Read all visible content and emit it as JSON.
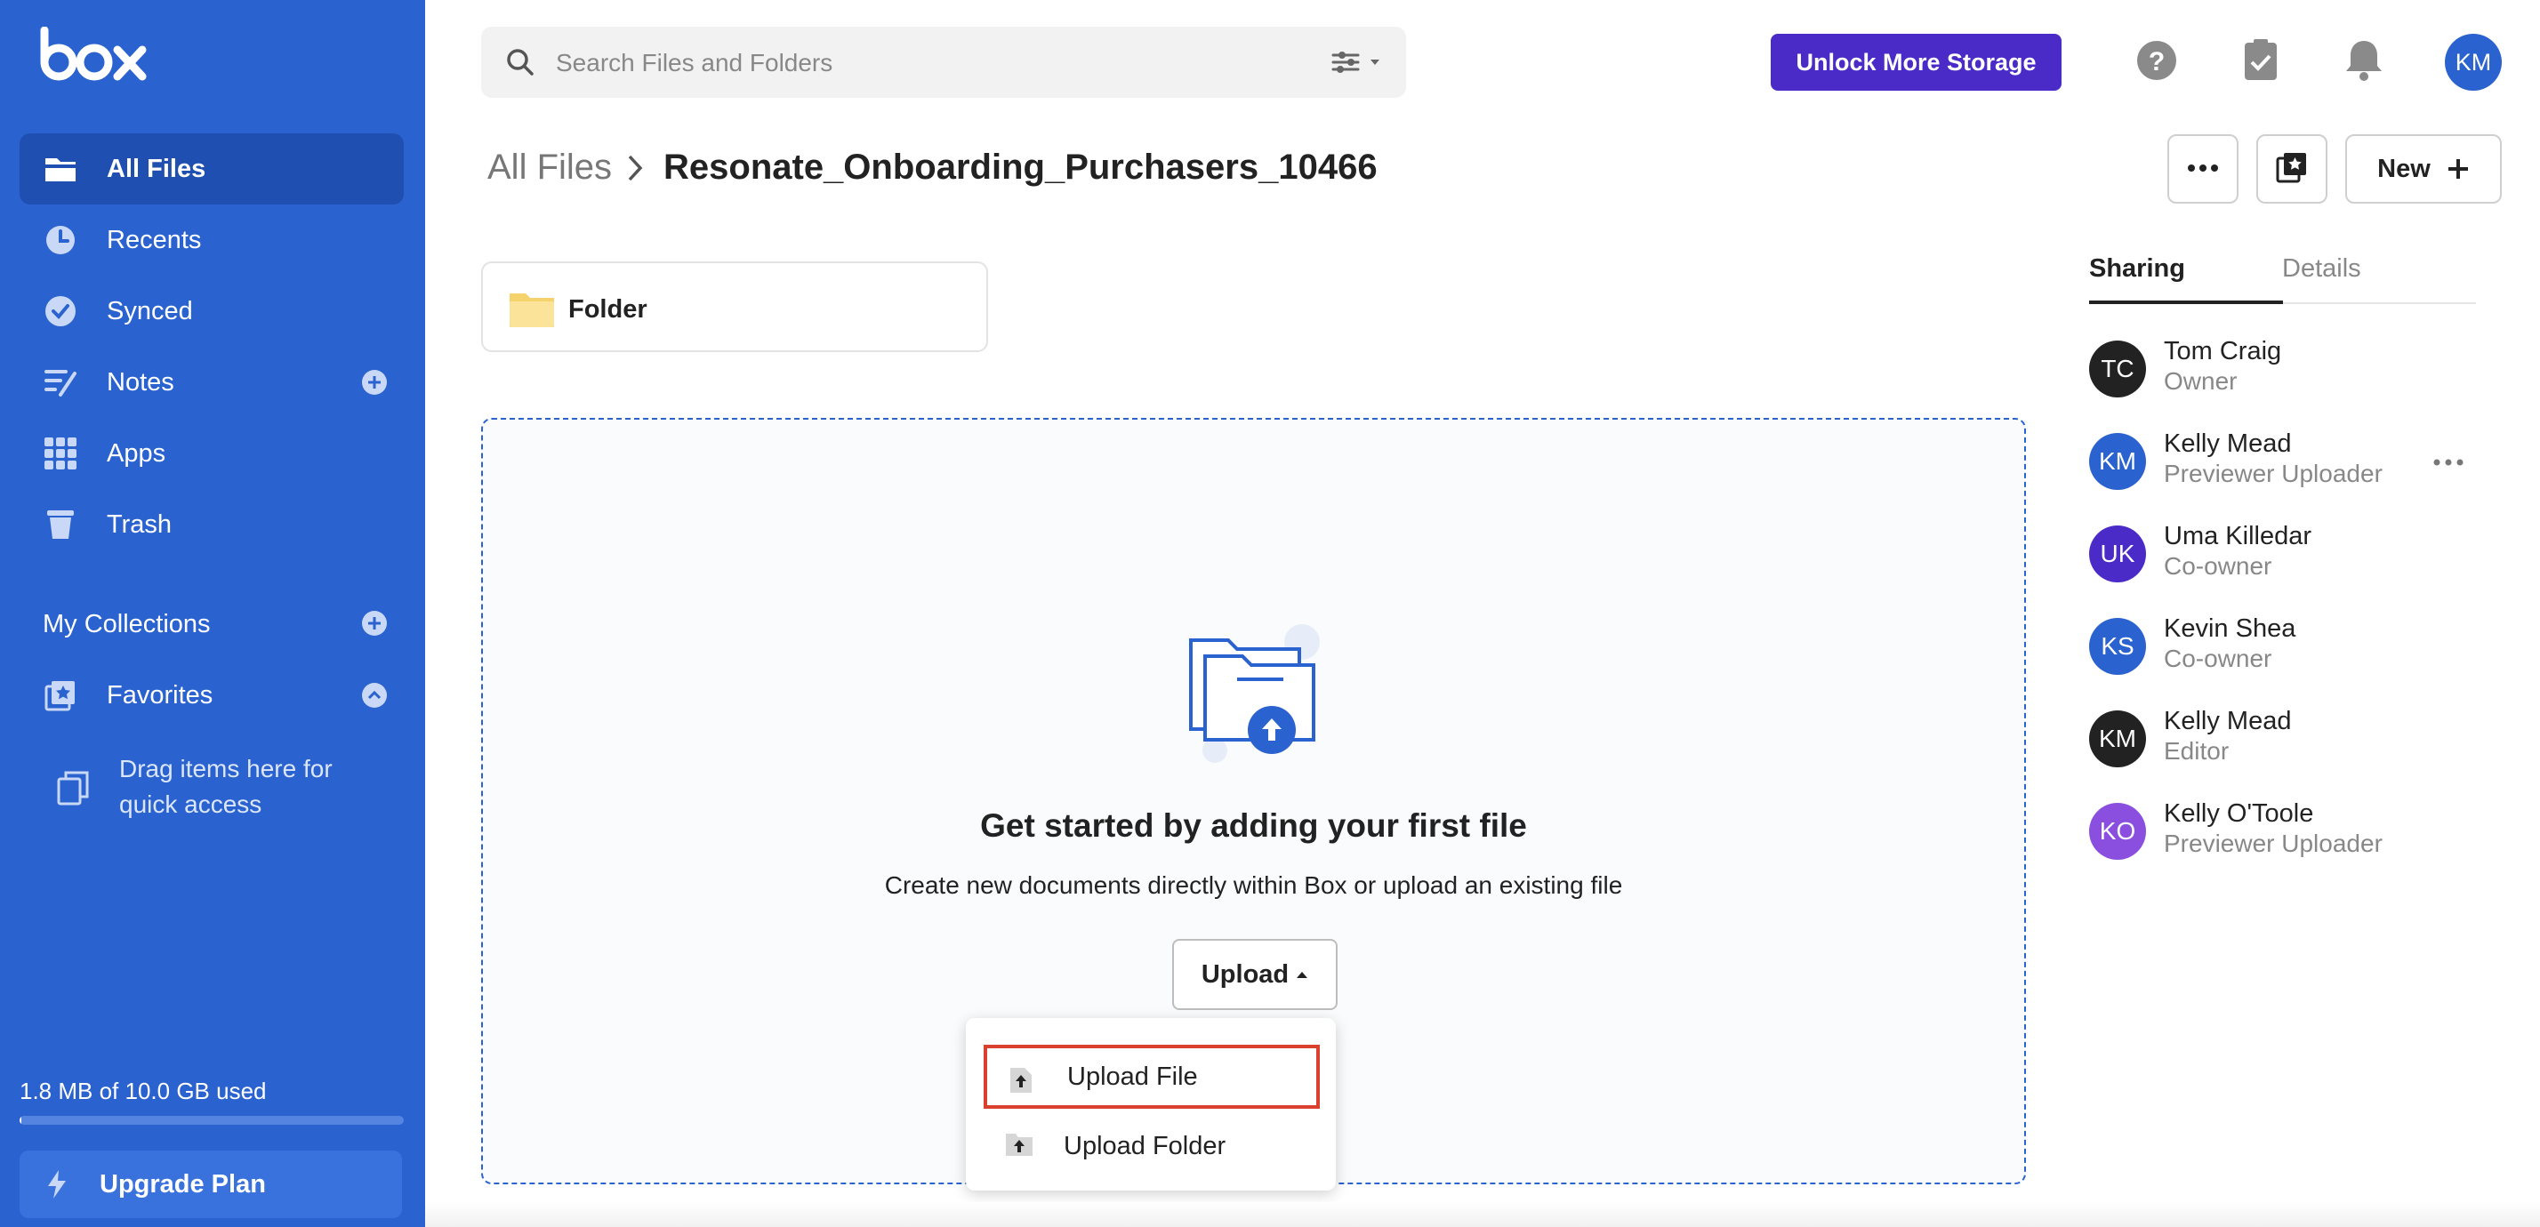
{
  "brand": {
    "logo_text": "box",
    "accent": "#2a62cf",
    "sidebar_active": "#1f4fb0"
  },
  "sidebar": {
    "items": [
      {
        "label": "All Files",
        "icon": "folder-icon",
        "active": true
      },
      {
        "label": "Recents",
        "icon": "clock-icon"
      },
      {
        "label": "Synced",
        "icon": "check-circle-icon"
      },
      {
        "label": "Notes",
        "icon": "notes-icon",
        "has_add": true
      },
      {
        "label": "Apps",
        "icon": "apps-grid-icon"
      },
      {
        "label": "Trash",
        "icon": "trash-icon"
      }
    ],
    "collections_label": "My Collections",
    "favorites_label": "Favorites",
    "drag_hint": "Drag items here for quick access",
    "storage_text": "1.8 MB of 10.0 GB used",
    "storage_fraction": 0.0002,
    "upgrade_label": "Upgrade Plan"
  },
  "search": {
    "placeholder": "Search Files and Folders",
    "value": ""
  },
  "header": {
    "unlock_label": "Unlock More Storage",
    "unlock_color": "#4b2bc7",
    "user_initials": "KM",
    "icons": [
      "help-icon",
      "tasks-clipboard-icon",
      "notifications-bell-icon"
    ]
  },
  "breadcrumb": {
    "root": "All Files",
    "current": "Resonate_Onboarding_Purchasers_10466"
  },
  "actions": {
    "new_label": "New"
  },
  "folder": {
    "label": "Folder"
  },
  "empty_state": {
    "title": "Get started by adding your first file",
    "subtitle": "Create new documents directly within Box or upload an existing file",
    "upload_label": "Upload"
  },
  "upload_menu": {
    "items": [
      {
        "label": "Upload File",
        "highlighted": true
      },
      {
        "label": "Upload Folder"
      }
    ]
  },
  "side_panel": {
    "tabs": [
      {
        "label": "Sharing",
        "active": true
      },
      {
        "label": "Details"
      }
    ],
    "collaborators": [
      {
        "initials": "TC",
        "name": "Tom Craig",
        "role": "Owner",
        "color": "#222222"
      },
      {
        "initials": "KM",
        "name": "Kelly Mead",
        "role": "Previewer Uploader",
        "color": "#2a62cf"
      },
      {
        "initials": "UK",
        "name": "Uma Killedar",
        "role": "Co-owner",
        "color": "#4b2bc7"
      },
      {
        "initials": "KS",
        "name": "Kevin Shea",
        "role": "Co-owner",
        "color": "#2a62cf"
      },
      {
        "initials": "KM",
        "name": "Kelly Mead",
        "role": "Editor",
        "color": "#222222"
      },
      {
        "initials": "KO",
        "name": "Kelly O'Toole",
        "role": "Previewer Uploader",
        "color": "#8b4fe0"
      }
    ]
  }
}
